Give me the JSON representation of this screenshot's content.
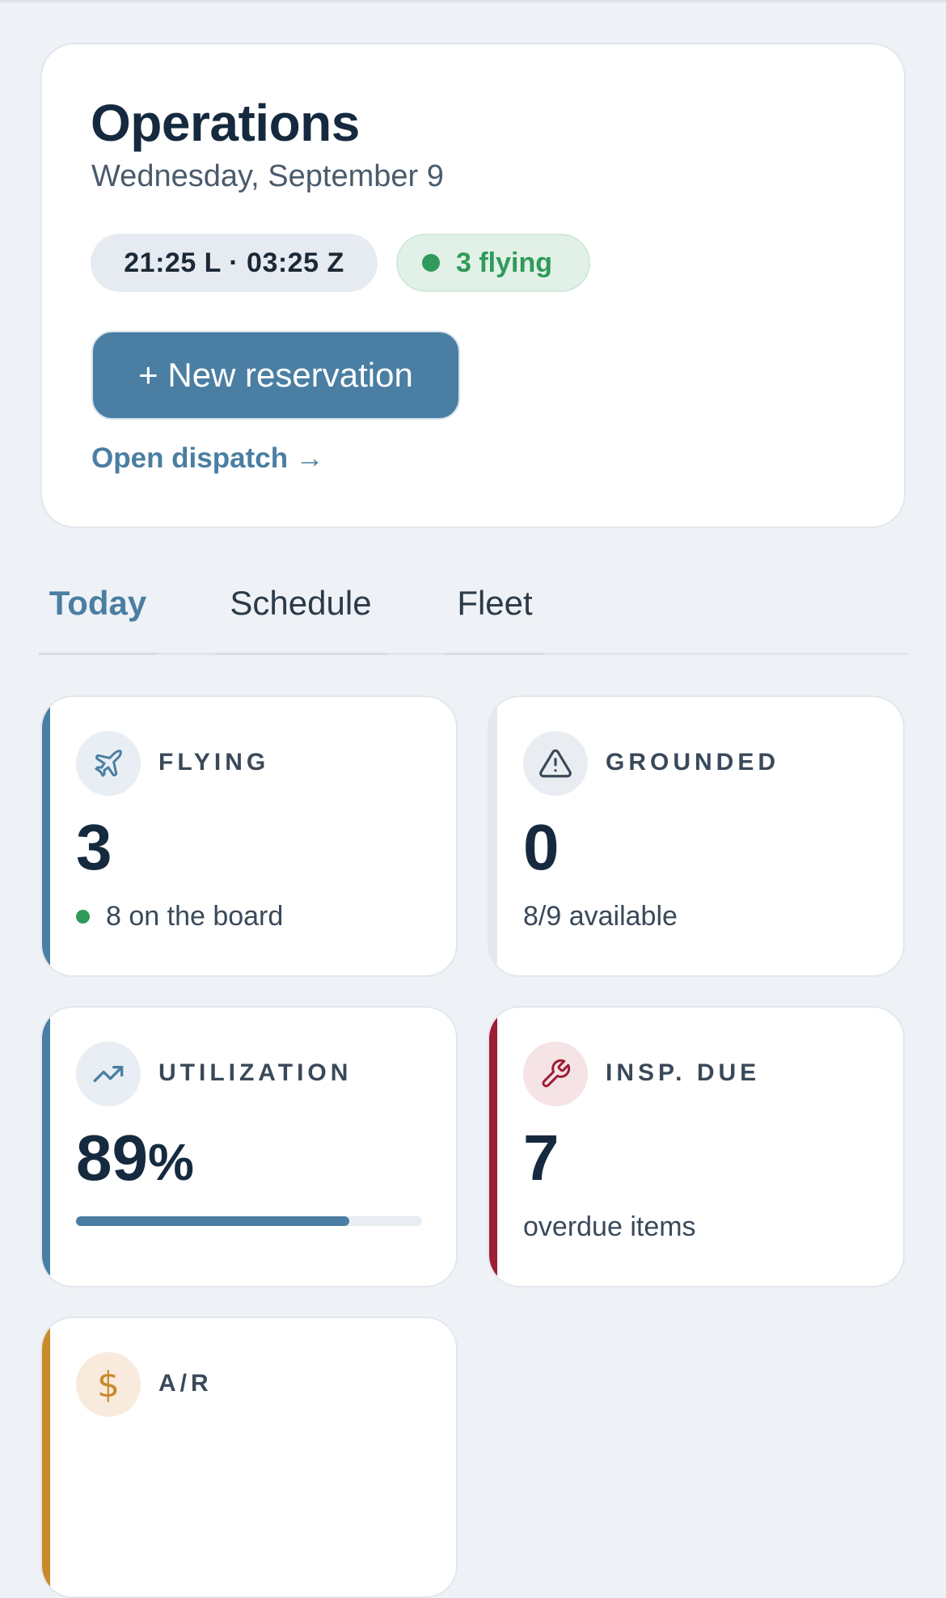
{
  "header": {
    "title": "Operations",
    "date": "Wednesday, September 9",
    "time_pill": "21:25 L · 03:25 Z",
    "flying_pill": "3 flying",
    "new_reservation": "+ New reservation",
    "open_dispatch": "Open dispatch →"
  },
  "tabs": [
    {
      "label": "Today",
      "active": true
    },
    {
      "label": "Schedule",
      "active": false
    },
    {
      "label": "Fleet",
      "active": false
    }
  ],
  "stats": {
    "flying": {
      "label": "FLYING",
      "value": "3",
      "sub": "8 on the board",
      "icon": "plane-icon",
      "accent": "#4a7ea2"
    },
    "grounded": {
      "label": "GROUNDED",
      "value": "0",
      "sub": "8/9 available",
      "icon": "warning-icon",
      "accent": "#e4e9ee"
    },
    "utilization": {
      "label": "UTILIZATION",
      "value": "89",
      "unit": "%",
      "progress": 0.79,
      "icon": "trending-up-icon",
      "accent": "#4a7ea2"
    },
    "insp_due": {
      "label": "INSP. DUE",
      "value": "7",
      "sub": "overdue items",
      "icon": "wrench-icon",
      "accent": "#9c1f35"
    },
    "ar": {
      "label": "A/R",
      "icon": "dollar-icon",
      "accent": "#c98a2c"
    }
  },
  "colors": {
    "brand": "#4a7ea2",
    "success": "#2f9a59",
    "danger": "#9c1f35",
    "warning": "#c98a2c"
  }
}
